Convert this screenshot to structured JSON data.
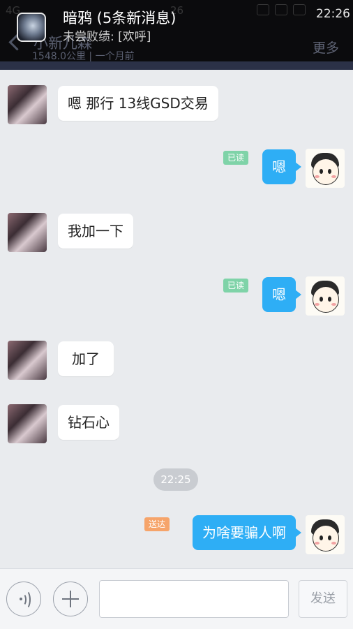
{
  "status_bar": {
    "left": "4G",
    "center": "26",
    "time": "22:26"
  },
  "notification": {
    "title": "暗鸦 (5条新消息)",
    "preview": "未尝败绩: [欢呼]"
  },
  "chat_header": {
    "contact_name": "小新儿森",
    "distance_info": "1548.0公里 | 一个月前",
    "more_label": "更多"
  },
  "messages": [
    {
      "side": "left",
      "text": "嗯 那行 13线GSD交易"
    },
    {
      "side": "right",
      "text": "嗯",
      "status": "已读"
    },
    {
      "side": "left",
      "text": "我加一下"
    },
    {
      "side": "right",
      "text": "嗯",
      "status": "已读"
    },
    {
      "side": "left",
      "text": "加了"
    },
    {
      "side": "left",
      "text": "钻石心"
    },
    {
      "side": "right",
      "text": "为啥要骗人啊",
      "status": "送达"
    }
  ],
  "timestamp": "22:25",
  "input_bar": {
    "input_value": "",
    "send_label": "发送"
  },
  "colors": {
    "own_bubble": "#2eaef5",
    "read_badge": "#7fd3a8",
    "sent_badge": "#f6a46a",
    "chat_background": "#e9ebee"
  },
  "icons": {
    "voice": "voice-icon",
    "add": "plus-icon",
    "back": "back-chevron-icon"
  }
}
